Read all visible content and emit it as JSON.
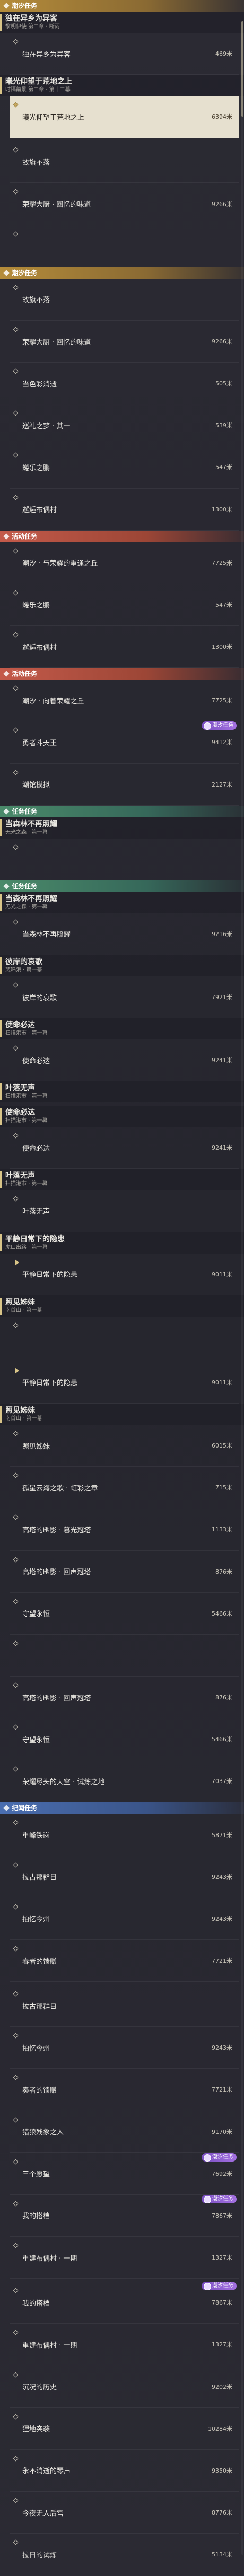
{
  "sections": [
    {
      "type": "section",
      "color": "gold",
      "label": "潮汐任务"
    },
    {
      "type": "quest",
      "title": "独在异乡为异客",
      "sub": "黎明伊使 第二章 · 断雨"
    },
    {
      "type": "row",
      "label": "独在异乡为异客",
      "dist": "469米"
    },
    {
      "type": "quest",
      "title": "曦光仰望于荒地之上",
      "sub": "时隔前景 第二章 · 第十二幕"
    },
    {
      "type": "row",
      "label": "曦光仰望于荒地之上",
      "dist": "6394米",
      "highlight": true
    },
    {
      "type": "gap"
    },
    {
      "type": "row",
      "label": "故旗不落",
      "dist": ""
    },
    {
      "type": "row",
      "label": "荣耀大厨 · 回忆的味道",
      "dist": "9266米"
    },
    {
      "type": "row",
      "label": "",
      "dist": ""
    },
    {
      "type": "section",
      "color": "gold",
      "label": "潮汐任务"
    },
    {
      "type": "row",
      "label": "故旗不落",
      "dist": ""
    },
    {
      "type": "row",
      "label": "荣耀大厨 · 回忆的味道",
      "dist": "9266米"
    },
    {
      "type": "row",
      "label": "当色彩消逝",
      "dist": "505米"
    },
    {
      "type": "row",
      "label": "巡礼之梦 · 其一",
      "dist": "539米"
    },
    {
      "type": "row",
      "label": "蜷乐之鹏",
      "dist": "547米"
    },
    {
      "type": "row",
      "label": "邂逅布偶村",
      "dist": "1300米"
    },
    {
      "type": "section",
      "color": "red",
      "label": "活动任务"
    },
    {
      "type": "row",
      "label": "潮汐 · 与荣耀的重逢之丘",
      "dist": "7725米"
    },
    {
      "type": "row",
      "label": "蜷乐之鹏",
      "dist": "547米"
    },
    {
      "type": "row",
      "label": "邂逅布偶村",
      "dist": "1300米"
    },
    {
      "type": "section",
      "color": "red",
      "label": "活动任务"
    },
    {
      "type": "row",
      "label": "潮汐 · 向着荣耀之丘",
      "dist": "7725米"
    },
    {
      "type": "row",
      "label": "勇者斗天王",
      "dist": "9412米",
      "badge": "潮汐任务"
    },
    {
      "type": "row",
      "label": "潮馆模拟",
      "dist": "2127米"
    },
    {
      "type": "section",
      "color": "green",
      "label": "任务任务"
    },
    {
      "type": "quest",
      "title": "当森林不再照耀",
      "sub": "无光之森 · 第一幕"
    },
    {
      "type": "row",
      "label": "",
      "dist": ""
    },
    {
      "type": "section",
      "color": "green",
      "label": "任务任务"
    },
    {
      "type": "quest",
      "title": "当森林不再照耀",
      "sub": "无光之森 · 第一幕"
    },
    {
      "type": "row",
      "label": "当森林不再照耀",
      "dist": "9216米"
    },
    {
      "type": "quest",
      "title": "彼岸的哀歌",
      "sub": "悲鸣港 · 第一幕"
    },
    {
      "type": "row",
      "label": "彼岸的哀歌",
      "dist": "7921米"
    },
    {
      "type": "quest",
      "title": "使命必达",
      "sub": "扫描港市 · 第一幕"
    },
    {
      "type": "row",
      "label": "使命必达",
      "dist": "9241米"
    },
    {
      "type": "quest",
      "title": "叶落无声",
      "sub": "扫描港市 · 第一幕"
    },
    {
      "type": "gap"
    },
    {
      "type": "quest",
      "title": "使命必达",
      "sub": "扫描港市 · 第一幕"
    },
    {
      "type": "row",
      "label": "使命必达",
      "dist": "9241米"
    },
    {
      "type": "quest",
      "title": "叶落无声",
      "sub": "扫描港市 · 第一幕"
    },
    {
      "type": "row",
      "label": "叶落无声",
      "dist": ""
    },
    {
      "type": "quest",
      "title": "平静日常下的隐患",
      "sub": "虎口出路 · 第一幕"
    },
    {
      "type": "row",
      "label": "平静日常下的隐患",
      "dist": "9011米",
      "arrow": true
    },
    {
      "type": "quest",
      "title": "照见姊妹",
      "sub": "南首山 · 第一幕"
    },
    {
      "type": "row",
      "label": "",
      "dist": ""
    },
    {
      "type": "gap"
    },
    {
      "type": "row",
      "label": "平静日常下的隐患",
      "dist": "9011米",
      "arrow": true
    },
    {
      "type": "quest",
      "title": "照见姊妹",
      "sub": "南首山 · 第一幕"
    },
    {
      "type": "row",
      "label": "照见姊妹",
      "dist": "6015米"
    },
    {
      "type": "row",
      "label": "孤星云海之歌 · 虹彩之章",
      "dist": "715米"
    },
    {
      "type": "row",
      "label": "高塔的幽影 · 暮光冠塔",
      "dist": "1133米"
    },
    {
      "type": "row",
      "label": "高塔的幽影 · 回声冠塔",
      "dist": "876米"
    },
    {
      "type": "row",
      "label": "守望永恒",
      "dist": "5466米"
    },
    {
      "type": "row",
      "label": "",
      "dist": ""
    },
    {
      "type": "row",
      "label": "高塔的幽影 · 回声冠塔",
      "dist": "876米"
    },
    {
      "type": "row",
      "label": "守望永恒",
      "dist": "5466米"
    },
    {
      "type": "row",
      "label": "荣耀尽头的天空 · 试炼之地",
      "dist": "7037米"
    },
    {
      "type": "section",
      "color": "blue",
      "label": "纪闻任务"
    },
    {
      "type": "row",
      "label": "重峰铁岗",
      "dist": "5871米"
    },
    {
      "type": "row",
      "label": "拉古那群日",
      "dist": "9243米"
    },
    {
      "type": "row",
      "label": "拍忆今州",
      "dist": "9243米"
    },
    {
      "type": "row",
      "label": "春者的馈赠",
      "dist": "7721米"
    },
    {
      "type": "gap"
    },
    {
      "type": "row",
      "label": "拉古那群日",
      "dist": ""
    },
    {
      "type": "row",
      "label": "拍忆今州",
      "dist": "9243米"
    },
    {
      "type": "row",
      "label": "奏者的馈赠",
      "dist": "7721米"
    },
    {
      "type": "row",
      "label": "猎狼残象之人",
      "dist": "9170米"
    },
    {
      "type": "row",
      "label": "三个愿望",
      "dist": "7692米",
      "badge": "潮汐任务"
    },
    {
      "type": "row",
      "label": "我的搭档",
      "dist": "7867米",
      "badge": "潮汐任务"
    },
    {
      "type": "row",
      "label": "重建布偶村 · 一期",
      "dist": "1327米"
    },
    {
      "type": "gap"
    },
    {
      "type": "row",
      "label": "我的搭档",
      "dist": "7867米",
      "badge": "潮汐任务"
    },
    {
      "type": "row",
      "label": "重建布偶村 · 一期",
      "dist": "1327米"
    },
    {
      "type": "row",
      "label": "沉况的历史",
      "dist": "9202米"
    },
    {
      "type": "row",
      "label": "狸地突袭",
      "dist": "10284米"
    },
    {
      "type": "row",
      "label": "永不消逝的琴声",
      "dist": "9350米"
    },
    {
      "type": "row",
      "label": "今夜无人后宫",
      "dist": "8776米"
    },
    {
      "type": "row",
      "label": "拉日的试炼",
      "dist": "5134米"
    }
  ],
  "colors": {
    "accent": "#d8c488",
    "badge": "#a370e0",
    "gold": "#b58c3a",
    "red": "#c45a4a",
    "green": "#4a8a6a",
    "blue": "#4a6eb0"
  }
}
